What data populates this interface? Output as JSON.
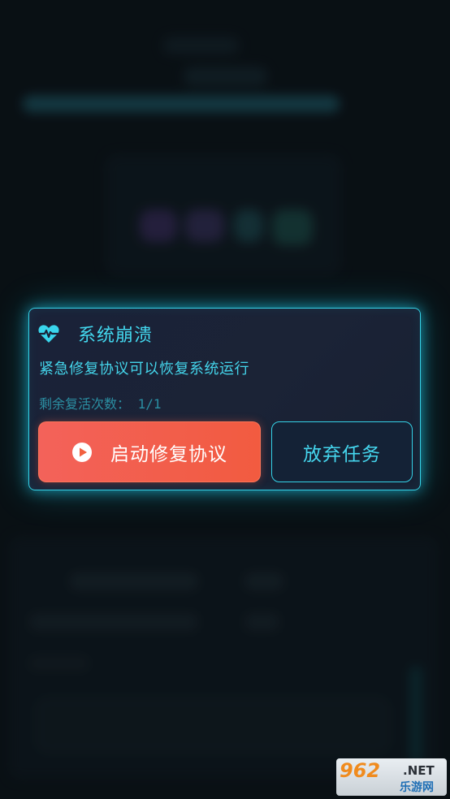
{
  "dialog": {
    "title": "系统崩溃",
    "description": "紧急修复协议可以恢复系统运行",
    "revive_count": "剩余复活次数： 1/1",
    "start_button": "启动修复协议",
    "abandon_button": "放弃任务",
    "accent_color": "#35d3e8",
    "primary_color": "#f25b40"
  },
  "icons": {
    "title_icon": "heart-pulse-icon",
    "start_icon": "play-icon"
  },
  "watermark": {
    "number": "962",
    "suffix": ".NET",
    "site": "乐游网"
  }
}
